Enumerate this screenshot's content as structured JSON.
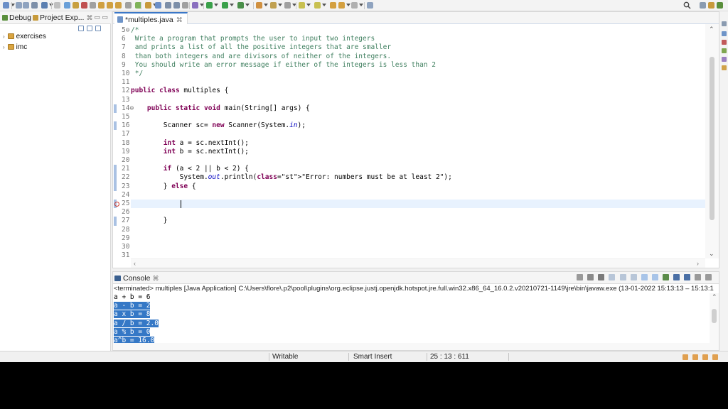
{
  "left_panel": {
    "tabs": [
      {
        "label": "Debug",
        "close": ""
      },
      {
        "label": "Project Exp...",
        "close": "⌘"
      }
    ],
    "window_controls": "▭ ▭",
    "tree": [
      {
        "label": "exercises"
      },
      {
        "label": "imc"
      }
    ]
  },
  "editor": {
    "tab_label": "*multiples.java",
    "tab_close": "⌘",
    "lines": [
      {
        "num": "5⊖",
        "code": "/*"
      },
      {
        "num": "6",
        "code": " Write a program that prompts the user to input two integers"
      },
      {
        "num": "7",
        "code": " and prints a list of all the positive integers that are smaller"
      },
      {
        "num": "8",
        "code": " than both integers and are divisors of neither of the integers."
      },
      {
        "num": "9",
        "code": " You should write an error message if either of the integers is less than 2"
      },
      {
        "num": "10",
        "code": " */"
      },
      {
        "num": "11",
        "code": ""
      },
      {
        "num": "12",
        "code": "public class multiples {"
      },
      {
        "num": "13",
        "code": ""
      },
      {
        "num": "14⊖",
        "code": "    public static void main(String[] args) {"
      },
      {
        "num": "15",
        "code": ""
      },
      {
        "num": "16",
        "code": "        Scanner sc= new Scanner(System.in);"
      },
      {
        "num": "17",
        "code": ""
      },
      {
        "num": "18",
        "code": "        int a = sc.nextInt();"
      },
      {
        "num": "19",
        "code": "        int b = sc.nextInt();"
      },
      {
        "num": "20",
        "code": ""
      },
      {
        "num": "21",
        "code": "        if (a < 2 || b < 2) {"
      },
      {
        "num": "22",
        "code": "            System.out.println(\"Error: numbers must be at least 2\");"
      },
      {
        "num": "23",
        "code": "        } else {"
      },
      {
        "num": "24",
        "code": ""
      },
      {
        "num": "25",
        "code": ""
      },
      {
        "num": "26",
        "code": ""
      },
      {
        "num": "27",
        "code": "        }"
      },
      {
        "num": "28",
        "code": ""
      },
      {
        "num": "29",
        "code": ""
      },
      {
        "num": "30",
        "code": ""
      },
      {
        "num": "31",
        "code": ""
      }
    ]
  },
  "console": {
    "tab_label": "Console",
    "tab_close": "⌘",
    "status": "<terminated> multiples [Java Application] C:\\Users\\flore\\.p2\\pool\\plugins\\org.eclipse.justj.openjdk.hotspot.jre.full.win32.x86_64_16.0.2.v20210721-1149\\jre\\bin\\javaw.exe  (13-01-2022 15:13:13 – 15:13:1",
    "output": [
      {
        "text": "a + b = 6",
        "selected": false
      },
      {
        "text": "a - b = 2",
        "selected": true
      },
      {
        "text": "a x b = 8",
        "selected": true
      },
      {
        "text": "a / b = 2.0",
        "selected": true
      },
      {
        "text": "a % b = 0",
        "selected": true
      },
      {
        "text": "a^b = 16.0",
        "selected": true
      }
    ]
  },
  "statusbar": {
    "writable": "Writable",
    "insert_mode": "Smart Insert",
    "position": "25 : 13 : 611"
  },
  "colors": {
    "keyword": "#7f0055",
    "comment": "#3f7f5f",
    "string": "#2a00ff",
    "field": "#0000c0",
    "selection": "#3578c6",
    "current_line": "#e8f2fe"
  }
}
